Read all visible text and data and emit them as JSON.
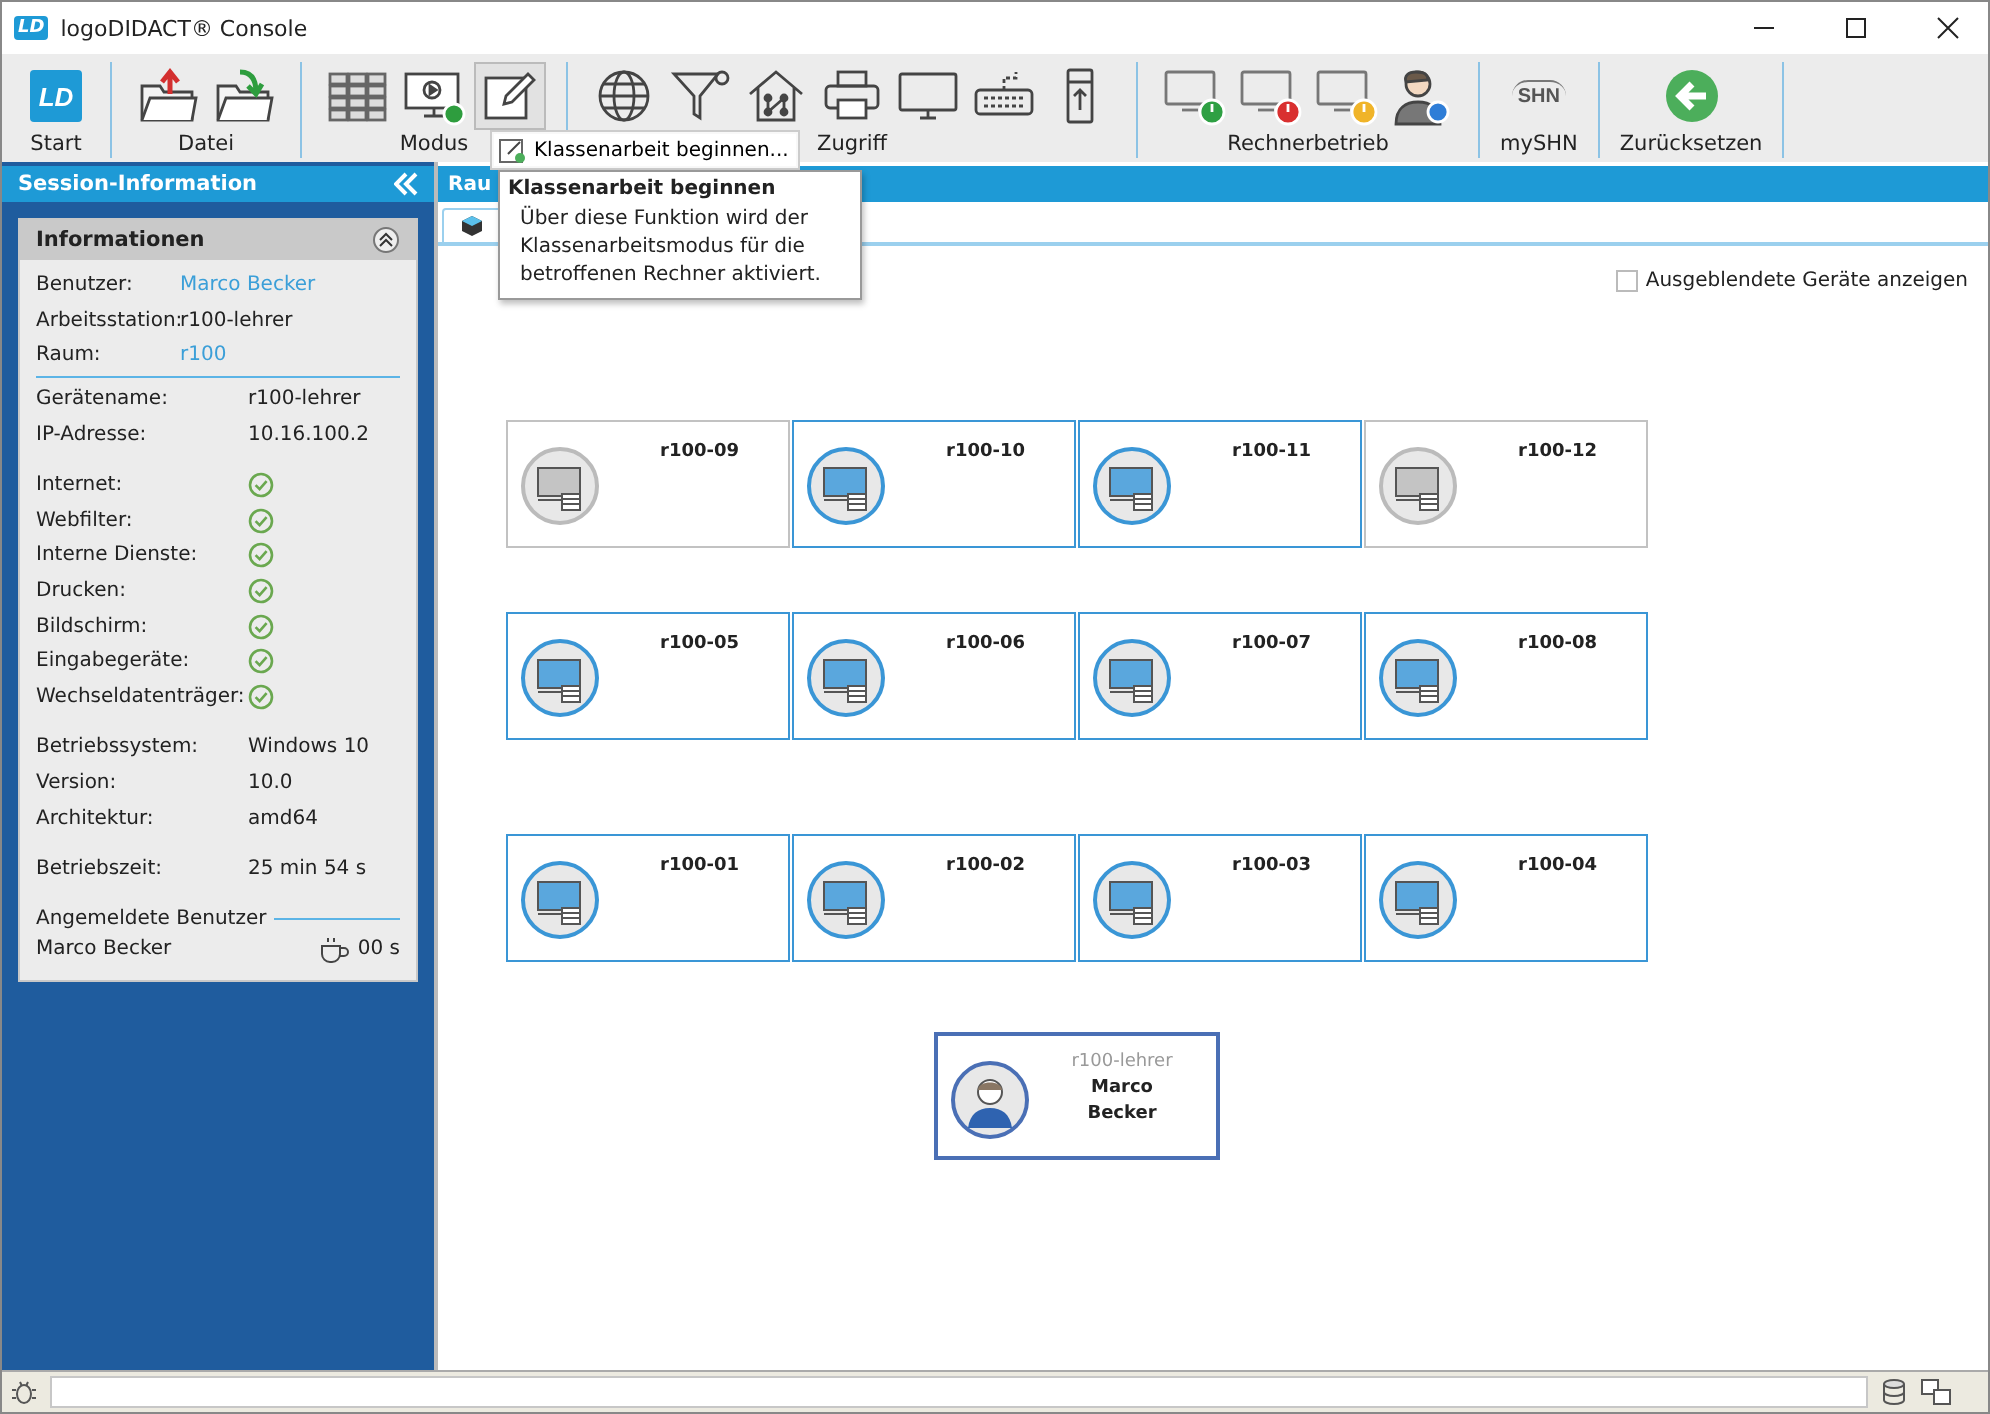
{
  "window": {
    "logo": "LD",
    "title": "logoDIDACT® Console"
  },
  "toolbar": [
    {
      "label": "Start",
      "items": [
        {
          "kind": "logo",
          "text": "LD",
          "selected": false
        }
      ]
    },
    {
      "label": "Datei",
      "items": [
        {
          "kind": "folder-up",
          "selected": false
        },
        {
          "kind": "folder-down",
          "selected": false
        }
      ]
    },
    {
      "label": "Modus",
      "items": [
        {
          "kind": "grid",
          "selected": false
        },
        {
          "kind": "monitor-play",
          "selected": false
        },
        {
          "kind": "pen",
          "selected": true
        }
      ]
    },
    {
      "label": "Zugriff",
      "items": [
        {
          "kind": "globe",
          "selected": false
        },
        {
          "kind": "filter",
          "selected": false
        },
        {
          "kind": "house",
          "selected": false
        },
        {
          "kind": "printer",
          "selected": false
        },
        {
          "kind": "monitor",
          "selected": false
        },
        {
          "kind": "keyboard",
          "selected": false
        },
        {
          "kind": "usb",
          "selected": false
        }
      ]
    },
    {
      "label": "Rechnerbetrieb",
      "items": [
        {
          "kind": "pc-power",
          "color": "#2ea043",
          "selected": false
        },
        {
          "kind": "pc-power",
          "color": "#d93030",
          "selected": false
        },
        {
          "kind": "pc-power",
          "color": "#f0b429",
          "selected": false
        },
        {
          "kind": "user-info",
          "selected": false
        }
      ]
    },
    {
      "label": "mySHN",
      "items": [
        {
          "kind": "shn",
          "text": "SHN",
          "selected": false
        }
      ]
    },
    {
      "label": "Zurücksetzen",
      "items": [
        {
          "kind": "back",
          "selected": false
        }
      ]
    }
  ],
  "dropdown": {
    "item": "Klassenarbeit beginnen..."
  },
  "tooltip": {
    "title": "Klassenarbeit beginnen",
    "body": "Über diese Funktion wird der Klassenarbeitsmodus für die betroffenen Rechner aktiviert."
  },
  "sidebar": {
    "title": "Session-Information",
    "panel": {
      "title": "Informationen",
      "groups": [
        [
          {
            "label": "Benutzer:",
            "value": "Marco Becker",
            "kind": "link"
          },
          {
            "label": "Arbeitsstation:",
            "value": "r100-lehrer",
            "kind": "text"
          },
          {
            "label": "Raum:",
            "value": "r100",
            "kind": "link"
          }
        ],
        [
          {
            "label": "Gerätename:",
            "value": "r100-lehrer",
            "kind": "text"
          },
          {
            "label": "IP-Adresse:",
            "value": "10.16.100.2",
            "kind": "text"
          }
        ],
        [
          {
            "label": "Internet:",
            "kind": "status",
            "ok": true
          },
          {
            "label": "Webfilter:",
            "kind": "status",
            "ok": true
          },
          {
            "label": "Interne Dienste:",
            "kind": "status",
            "ok": true
          },
          {
            "label": "Drucken:",
            "kind": "status",
            "ok": true
          },
          {
            "label": "Bildschirm:",
            "kind": "status",
            "ok": true
          },
          {
            "label": "Eingabegeräte:",
            "kind": "status",
            "ok": true
          },
          {
            "label": "Wechseldatenträger:",
            "kind": "status",
            "ok": true
          }
        ],
        [
          {
            "label": "Betriebssystem:",
            "value": "Windows 10",
            "kind": "text"
          },
          {
            "label": "Version:",
            "value": "10.0",
            "kind": "text"
          },
          {
            "label": "Architektur:",
            "value": "amd64",
            "kind": "text"
          }
        ],
        [
          {
            "label": "Betriebszeit:",
            "value": "25 min 54 s",
            "kind": "text"
          }
        ]
      ],
      "users_title": "Angemeldete Benutzer",
      "users": [
        {
          "name": "Marco Becker",
          "idle": "00 s"
        }
      ]
    }
  },
  "room": {
    "header": "Rau",
    "show_hidden": {
      "label": "Ausgeblendete Geräte anzeigen",
      "checked": false
    },
    "computers": [
      {
        "name": "r100-09",
        "online": false
      },
      {
        "name": "r100-10",
        "online": true
      },
      {
        "name": "r100-11",
        "online": true
      },
      {
        "name": "r100-12",
        "online": false
      },
      {
        "name": "r100-05",
        "online": true
      },
      {
        "name": "r100-06",
        "online": true
      },
      {
        "name": "r100-07",
        "online": true
      },
      {
        "name": "r100-08",
        "online": true
      },
      {
        "name": "r100-01",
        "online": true
      },
      {
        "name": "r100-02",
        "online": true
      },
      {
        "name": "r100-03",
        "online": true
      },
      {
        "name": "r100-04",
        "online": true
      }
    ],
    "teacher": {
      "station": "r100-lehrer",
      "first": "Marco",
      "last": "Becker"
    }
  }
}
